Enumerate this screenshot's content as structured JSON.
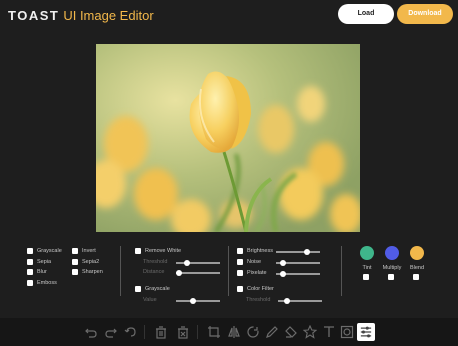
{
  "header": {
    "brand": "TOAST",
    "product": "UI Image Editor",
    "load_label": "Load",
    "download_label": "Download"
  },
  "filters": {
    "col1": [
      "Grayscale",
      "Sepia",
      "Blur",
      "Emboss"
    ],
    "col2": [
      "Invert",
      "Sepia2",
      "Sharpen"
    ],
    "remove_white": "Remove White",
    "threshold": "Threshold",
    "distance": "Distance",
    "gradient_transparency": "Grayscale",
    "value": "Value",
    "brightness": "Brightness",
    "noise": "Noise",
    "pixelate": "Pixelate",
    "color_filter": "Color Filter",
    "color_threshold": "Threshold",
    "tint": "Tint",
    "multiply": "Multiply",
    "blend": "Blend"
  },
  "colors": {
    "accent": "#f2b84b",
    "tint": "#3fb68b",
    "multiply": "#515ce6",
    "blend": "#f2b84b",
    "background": "#1e1e1e"
  },
  "toolbar_icons": [
    "undo-icon",
    "redo-icon",
    "reset-icon",
    "delete-icon",
    "delete-all-icon",
    "crop-icon",
    "flip-icon",
    "rotate-icon",
    "draw-icon",
    "shape-icon",
    "icon-tool-icon",
    "text-icon",
    "mask-icon",
    "filter-icon"
  ]
}
